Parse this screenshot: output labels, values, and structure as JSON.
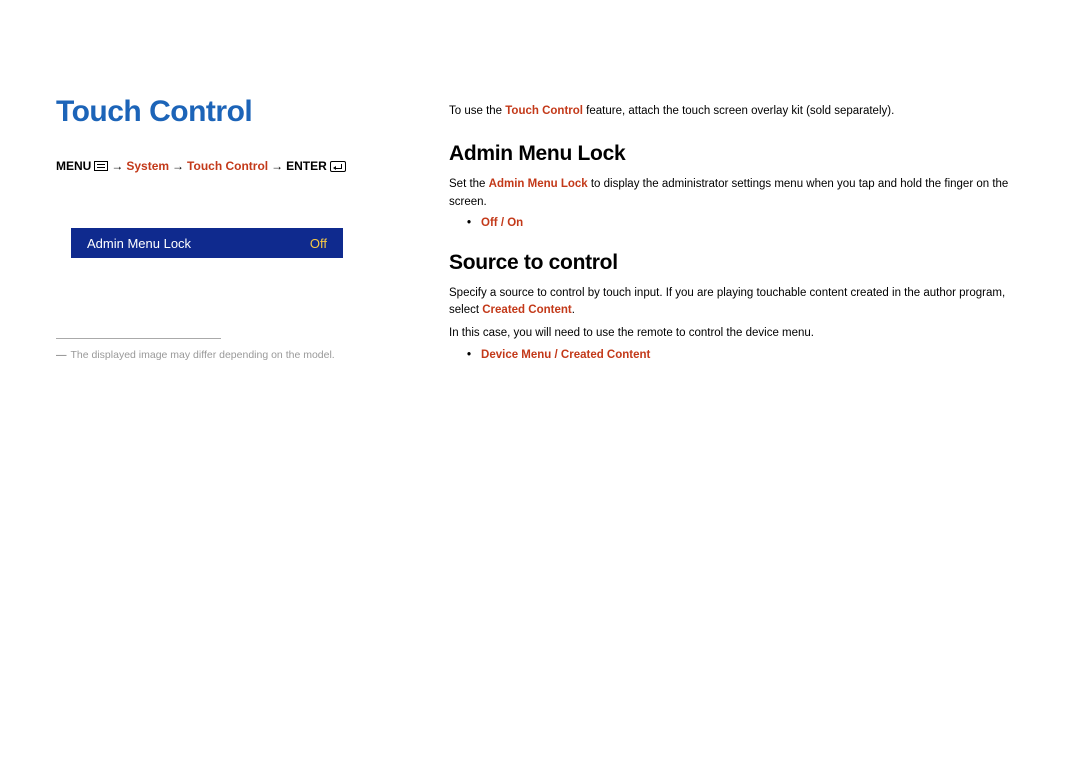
{
  "left": {
    "title": "Touch Control",
    "breadcrumb": {
      "menu_label": "MENU",
      "arrow": "→",
      "system": "System",
      "touch_control": "Touch Control",
      "enter_label": "ENTER"
    },
    "menu_item": {
      "label": "Admin Menu Lock",
      "value": "Off"
    },
    "footnote": "The displayed image may differ depending on the model."
  },
  "right": {
    "intro_prefix": "To use the ",
    "intro_bold": "Touch Control",
    "intro_suffix": " feature, attach the touch screen overlay kit (sold separately).",
    "section1": {
      "heading": "Admin Menu Lock",
      "p_prefix": "Set the ",
      "p_bold": "Admin Menu Lock",
      "p_suffix": " to display the administrator settings menu when you tap and hold the finger on the screen.",
      "bullet": "Off / On"
    },
    "section2": {
      "heading": "Source to control",
      "p1_prefix": "Specify a source to control by touch input. If you are playing touchable content created in the author program, select ",
      "p1_bold": "Created Content",
      "p1_suffix": ".",
      "p2": "In this case, you will need to use the remote to control the device menu.",
      "bullet": "Device Menu / Created Content"
    }
  }
}
